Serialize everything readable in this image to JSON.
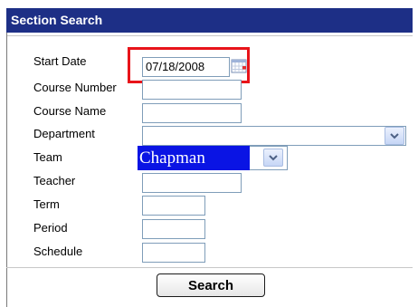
{
  "panel": {
    "title": "Section Search"
  },
  "labels": {
    "start_date": "Start Date",
    "course_number": "Course Number",
    "course_name": "Course Name",
    "department": "Department",
    "team": "Team",
    "teacher": "Teacher",
    "term": "Term",
    "period": "Period",
    "schedule": "Schedule"
  },
  "fields": {
    "start_date_value": "07/18/2008",
    "course_number_value": "",
    "course_name_value": "",
    "department_selected": "",
    "team_selected": "Chapman",
    "teacher_value": "",
    "term_value": "",
    "period_value": "",
    "schedule_value": ""
  },
  "buttons": {
    "search_label": "Search"
  },
  "icons": {
    "calendar": "calendar-icon",
    "dropdown": "chevron-down-icon"
  },
  "colors": {
    "title_bar": "#1d2f86",
    "highlight": "#e8141a",
    "team_selected_bg": "#0a14e4"
  }
}
